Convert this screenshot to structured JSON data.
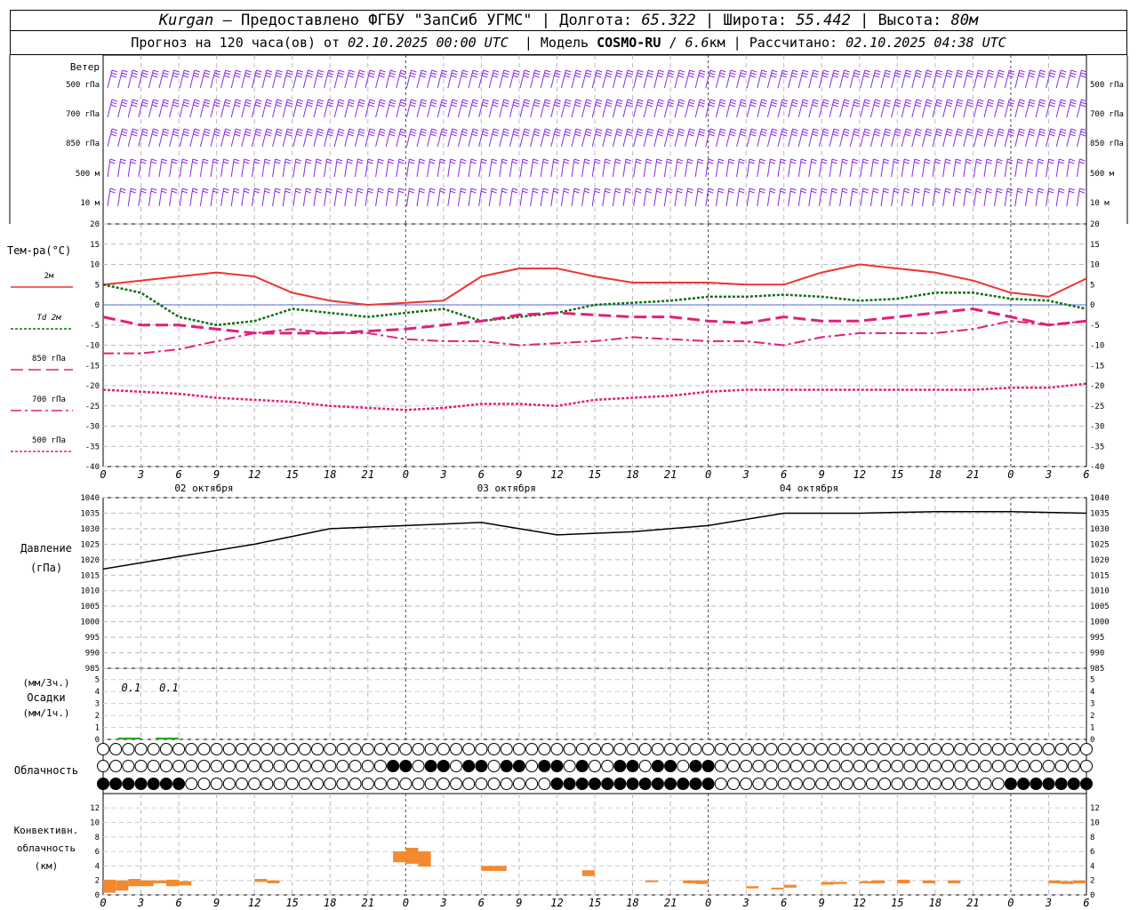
{
  "header": {
    "city": "Kurgan",
    "dash": "–",
    "provider": "Предоставлено ФГБУ \"ЗапСиб УГМС\"",
    "lon_label": "Долгота:",
    "lon": "65.322",
    "lat_label": "Широта:",
    "lat": "55.442",
    "alt_label": "Высота:",
    "alt": "80м",
    "forecast_prefix": "Прогноз на 120 часа(ов) от",
    "forecast_date": "02.10.2025 00:00 UTC",
    "model_label": "Модель",
    "model": "COSMO-RU",
    "model_res": "6.6",
    "model_res_unit": "км",
    "calc_label": "Рассчитано:",
    "calc_date": "02.10.2025 04:38 UTC"
  },
  "wind": {
    "title": "Ветер",
    "levels": [
      "500 гПа",
      "700 гПа",
      "850 гПа",
      "500 м",
      "10  м"
    ],
    "color": "#8a2be2"
  },
  "time_axis": {
    "ticks": [
      "0",
      "3",
      "6",
      "9",
      "12",
      "15",
      "18",
      "21",
      "0",
      "3",
      "6",
      "9",
      "12",
      "15",
      "18",
      "21",
      "0",
      "3",
      "6",
      "9",
      "12",
      "15",
      "18",
      "21",
      "0",
      "3",
      "6"
    ],
    "dates": [
      "02 октября",
      "03 октября",
      "04 октября"
    ]
  },
  "temperature": {
    "title": "Тем-ра(°C)",
    "ylim": [
      -40,
      20
    ],
    "ticks": [
      "20",
      "15",
      "10",
      "5",
      "0",
      "-5",
      "-10",
      "-15",
      "-20",
      "-25",
      "-30",
      "-35",
      "-40"
    ],
    "legend": [
      {
        "label": "2м",
        "color": "#ee3333",
        "style": "solid"
      },
      {
        "label": "Td  2м",
        "color": "#107010",
        "style": "dotted"
      },
      {
        "label": "850 гПа",
        "color": "#e0207a",
        "style": "dashed"
      },
      {
        "label": "700 гПа",
        "color": "#e0207a",
        "style": "dashdot"
      },
      {
        "label": "500 гПа",
        "color": "#e0207a",
        "style": "short-dot"
      }
    ]
  },
  "pressure": {
    "title": "Давление",
    "unit": "(гПа)",
    "ylim": [
      985,
      1040
    ],
    "ticks": [
      "1040",
      "1035",
      "1030",
      "1025",
      "1020",
      "1015",
      "1010",
      "1005",
      "1000",
      "995",
      "990",
      "985"
    ]
  },
  "precip": {
    "unit3": "(мм/3ч.)",
    "title": "Осадки",
    "unit1": "(мм/1ч.)",
    "ticks": [
      "5",
      "4",
      "3",
      "2",
      "1",
      "0"
    ],
    "annotations": [
      {
        "hour": 3,
        "text": "0.1"
      },
      {
        "hour": 6,
        "text": "0.1"
      }
    ],
    "color": "#22aa22"
  },
  "clouds": {
    "title": "Облачность"
  },
  "convective": {
    "title1": "Конвективн.",
    "title2": "облачность",
    "unit": "(км)",
    "ticks": [
      "12",
      "10",
      "8",
      "6",
      "4",
      "2",
      "0"
    ],
    "color": "#f28a30"
  },
  "chart_data": [
    {
      "type": "line",
      "title": "Тем-ра(°C)",
      "x_unit": "hours since 02.10.2025 00:00 UTC",
      "ylim": [
        -40,
        20
      ],
      "series": [
        {
          "name": "2м",
          "x": [
            0,
            3,
            6,
            9,
            12,
            15,
            18,
            21,
            24,
            27,
            30,
            33,
            36,
            39,
            42,
            45,
            48,
            51,
            54,
            57,
            60,
            63,
            66,
            69,
            72,
            75,
            78
          ],
          "values": [
            5,
            6,
            7,
            8,
            7,
            3,
            1,
            0,
            0.5,
            1,
            7,
            9,
            9,
            7,
            5.5,
            5.5,
            5.5,
            5,
            5,
            8,
            10,
            9,
            8,
            6,
            3,
            2,
            6.5
          ]
        },
        {
          "name": "Td  2м",
          "x": [
            0,
            3,
            6,
            9,
            12,
            15,
            18,
            21,
            24,
            27,
            30,
            33,
            36,
            39,
            42,
            45,
            48,
            51,
            54,
            57,
            60,
            63,
            66,
            69,
            72,
            75,
            78
          ],
          "values": [
            5,
            3,
            -3,
            -5,
            -4,
            -1,
            -2,
            -3,
            -2,
            -1,
            -4,
            -3,
            -2,
            0,
            0.5,
            1,
            2,
            2,
            2.5,
            2,
            1,
            1.5,
            3,
            3,
            1.5,
            1,
            -1
          ]
        },
        {
          "name": "850 гПа",
          "x": [
            0,
            3,
            6,
            9,
            12,
            15,
            18,
            21,
            24,
            27,
            30,
            33,
            36,
            39,
            42,
            45,
            48,
            51,
            54,
            57,
            60,
            63,
            66,
            69,
            72,
            75,
            78
          ],
          "values": [
            -3,
            -5,
            -5,
            -6,
            -7,
            -7,
            -7,
            -6.5,
            -6,
            -5,
            -4,
            -2.5,
            -2,
            -2.5,
            -3,
            -3,
            -4,
            -4.5,
            -3,
            -4,
            -4,
            -3,
            -2,
            -1,
            -3,
            -5,
            -4
          ]
        },
        {
          "name": "700 гПа",
          "x": [
            0,
            3,
            6,
            9,
            12,
            15,
            18,
            21,
            24,
            27,
            30,
            33,
            36,
            39,
            42,
            45,
            48,
            51,
            54,
            57,
            60,
            63,
            66,
            69,
            72,
            75,
            78
          ],
          "values": [
            -12,
            -12,
            -11,
            -9,
            -7,
            -6,
            -7,
            -7,
            -8.5,
            -9,
            -9,
            -10,
            -9.5,
            -9,
            -8,
            -8.5,
            -9,
            -9,
            -10,
            -8,
            -7,
            -7,
            -7,
            -6,
            -4,
            -5,
            -4
          ]
        },
        {
          "name": "500 гПа",
          "x": [
            0,
            3,
            6,
            9,
            12,
            15,
            18,
            21,
            24,
            27,
            30,
            33,
            36,
            39,
            42,
            45,
            48,
            51,
            54,
            57,
            60,
            63,
            66,
            69,
            72,
            75,
            78
          ],
          "values": [
            -21,
            -21.5,
            -22,
            -23,
            -23.5,
            -24,
            -25,
            -25.5,
            -26,
            -25.5,
            -24.5,
            -24.5,
            -25,
            -23.5,
            -23,
            -22.5,
            -21.5,
            -21,
            -21,
            -21,
            -21,
            -21,
            -21,
            -21,
            -20.5,
            -20.5,
            -19.5
          ]
        }
      ]
    },
    {
      "type": "line",
      "title": "Давление",
      "x_unit": "hours since 02.10.2025 00:00 UTC",
      "ylim": [
        985,
        1040
      ],
      "series": [
        {
          "x": [
            0,
            6,
            12,
            18,
            24,
            30,
            33,
            36,
            42,
            48,
            54,
            60,
            66,
            72,
            78
          ],
          "values": [
            1017,
            1021,
            1025,
            1030,
            1031,
            1032,
            1030,
            1028,
            1029,
            1031,
            1035,
            1035,
            1035.5,
            1035.5,
            1035
          ]
        }
      ]
    },
    {
      "type": "bar",
      "title": "Осадки",
      "x": [
        0,
        3,
        6
      ],
      "values": [
        0,
        0.1,
        0.1
      ]
    },
    {
      "type": "bar",
      "title": "Конвективн. облачность",
      "x_unit": "hours since 02.10.2025 00:00 UTC",
      "bars": [
        {
          "h": 0,
          "top": 2.1,
          "base": 0.3
        },
        {
          "h": 1,
          "top": 2.0,
          "base": 0.6
        },
        {
          "h": 2,
          "top": 2.2,
          "base": 1.2
        },
        {
          "h": 3,
          "top": 2.0,
          "base": 1.2
        },
        {
          "h": 4,
          "top": 2.0,
          "base": 1.6
        },
        {
          "h": 5,
          "top": 2.1,
          "base": 1.2
        },
        {
          "h": 6,
          "top": 1.9,
          "base": 1.3
        },
        {
          "h": 12,
          "top": 2.2,
          "base": 1.8
        },
        {
          "h": 13,
          "top": 2.0,
          "base": 1.6
        },
        {
          "h": 23,
          "top": 6.0,
          "base": 4.5
        },
        {
          "h": 24,
          "top": 6.5,
          "base": 4.3
        },
        {
          "h": 25,
          "top": 6.0,
          "base": 3.9
        },
        {
          "h": 30,
          "top": 4.0,
          "base": 3.3
        },
        {
          "h": 31,
          "top": 4.0,
          "base": 3.3
        },
        {
          "h": 38,
          "top": 3.4,
          "base": 2.6
        },
        {
          "h": 43,
          "top": 2.0,
          "base": 1.8
        },
        {
          "h": 46,
          "top": 2.0,
          "base": 1.6
        },
        {
          "h": 47,
          "top": 2.0,
          "base": 1.5
        },
        {
          "h": 51,
          "top": 1.2,
          "base": 0.9
        },
        {
          "h": 53,
          "top": 1.0,
          "base": 0.8
        },
        {
          "h": 54,
          "top": 1.4,
          "base": 1.0
        },
        {
          "h": 57,
          "top": 1.8,
          "base": 1.4
        },
        {
          "h": 58,
          "top": 1.8,
          "base": 1.5
        },
        {
          "h": 60,
          "top": 1.9,
          "base": 1.6
        },
        {
          "h": 61,
          "top": 2.0,
          "base": 1.6
        },
        {
          "h": 63,
          "top": 2.1,
          "base": 1.6
        },
        {
          "h": 65,
          "top": 2.0,
          "base": 1.6
        },
        {
          "h": 67,
          "top": 2.0,
          "base": 1.6
        },
        {
          "h": 75,
          "top": 2.0,
          "base": 1.6
        },
        {
          "h": 76,
          "top": 1.9,
          "base": 1.5
        },
        {
          "h": 77,
          "top": 2.0,
          "base": 1.6
        }
      ]
    }
  ]
}
